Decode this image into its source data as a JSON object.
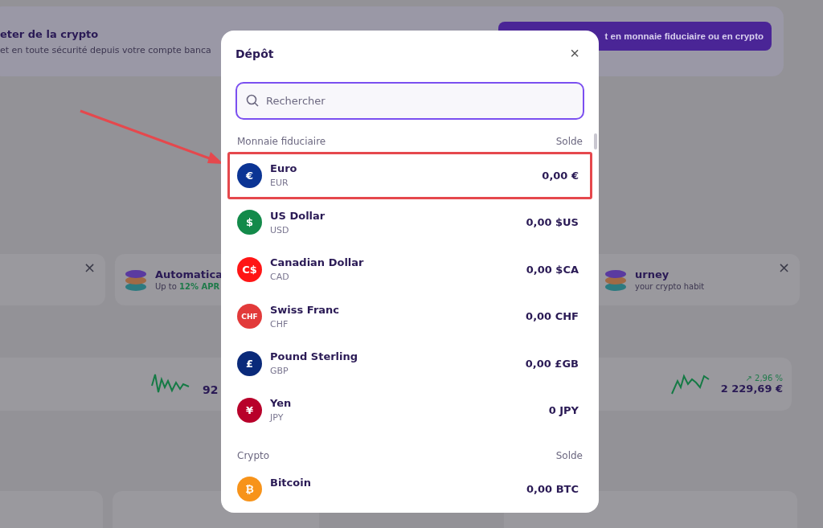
{
  "background": {
    "banner": {
      "title": "eter de la crypto",
      "subtitle": "et en toute sécurité depuis votre compte banca",
      "button": "t en monnaie fiduciaire ou en crypto"
    },
    "promo_cards": [
      {
        "close": "×"
      },
      {
        "title": "Automatica",
        "subtitle": "Up to **12% APR**"
      },
      {
        "title": "urney",
        "subtitle": "your crypto habit",
        "close": "×"
      }
    ],
    "market": {
      "left_value": "92",
      "change": "↗ 2,96 %",
      "value": "2 229,69 €"
    }
  },
  "dialog": {
    "title": "Dépôt",
    "close": "×",
    "search": {
      "placeholder": "Rechercher"
    },
    "sections": [
      {
        "title": "Monnaie fiduciaire",
        "balance_label": "Solde",
        "items": [
          {
            "name": "Euro",
            "code": "EUR",
            "balance": "0,00 €",
            "symbol": "€",
            "color": "#0b3494",
            "highlighted": true
          },
          {
            "name": "US Dollar",
            "code": "USD",
            "balance": "0,00 $US",
            "symbol": "$",
            "color": "#138a4a",
            "highlighted": false
          },
          {
            "name": "Canadian Dollar",
            "code": "CAD",
            "balance": "0,00 $CA",
            "symbol": "C$",
            "color": "#ff1616",
            "highlighted": false
          },
          {
            "name": "Swiss Franc",
            "code": "CHF",
            "balance": "0,00 CHF",
            "symbol": "CHF",
            "color": "#e23a3a",
            "highlighted": false
          },
          {
            "name": "Pound Sterling",
            "code": "GBP",
            "balance": "0,00 £GB",
            "symbol": "£",
            "color": "#0a2a7a",
            "highlighted": false
          },
          {
            "name": "Yen",
            "code": "JPY",
            "balance": "0 JPY",
            "symbol": "¥",
            "color": "#b8002a",
            "highlighted": false
          }
        ]
      },
      {
        "title": "Crypto",
        "balance_label": "Solde",
        "items": [
          {
            "name": "Bitcoin",
            "balance": "0,00 BTC",
            "symbol": "₿",
            "color": "#f7931a",
            "highlighted": false
          }
        ]
      }
    ]
  }
}
